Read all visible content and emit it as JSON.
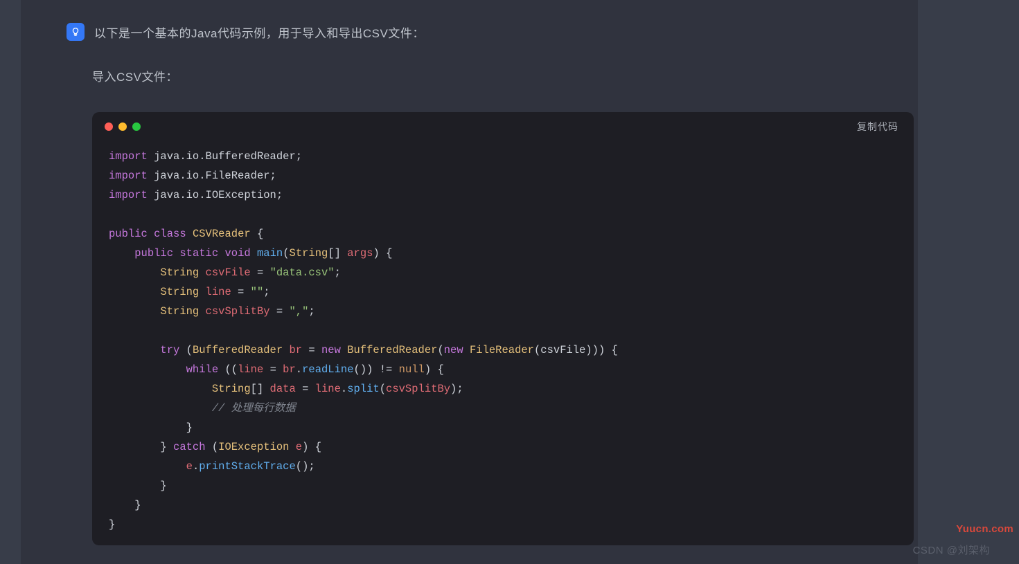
{
  "intro": "以下是一个基本的Java代码示例，用于导入和导出CSV文件：",
  "section_label": "导入CSV文件：",
  "copy_label": "复制代码",
  "watermark_csdn": "CSDN @刘架构",
  "watermark_site": "Yuucn.com",
  "code": {
    "l01": {
      "kw": "import",
      "rest": " java.io.BufferedReader;"
    },
    "l02": {
      "kw": "import",
      "rest": " java.io.FileReader;"
    },
    "l03": {
      "kw": "import",
      "rest": " java.io.IOException;"
    },
    "l05": {
      "kw1": "public",
      "kw2": "class",
      "cls": "CSVReader",
      "brace": " {"
    },
    "l06": {
      "kw1": "public",
      "kw2": "static",
      "kw3": "void",
      "fn": "main",
      "open": "(",
      "type": "String",
      "arr": "[] ",
      "arg": "args",
      "close": ") {"
    },
    "l07": {
      "type": "String",
      "var": " csvFile",
      "eq": " = ",
      "str": "\"data.csv\"",
      "semi": ";"
    },
    "l08": {
      "type": "String",
      "var": " line",
      "eq": " = ",
      "str": "\"\"",
      "semi": ";"
    },
    "l09": {
      "type": "String",
      "var": " csvSplitBy",
      "eq": " = ",
      "str": "\",\"",
      "semi": ";"
    },
    "l11": {
      "kw": "try",
      "open": " (",
      "type1": "BufferedReader",
      "var": " br",
      "eq": " = ",
      "kw2": "new",
      "sp": " ",
      "type2": "BufferedReader",
      "p1": "(",
      "kw3": "new",
      "sp2": " ",
      "type3": "FileReader",
      "p2": "(csvFile))) {"
    },
    "l12": {
      "kw": "while",
      "open": " ((",
      "var": "line",
      "eq": " = ",
      "obj": "br",
      "dot": ".",
      "fn": "readLine",
      "call": "()) != ",
      "null": "null",
      "close": ") {"
    },
    "l13": {
      "type": "String",
      "arr": "[] ",
      "var": "data",
      "eq": " = ",
      "obj": "line",
      "dot": ".",
      "fn": "split",
      "open": "(",
      "arg": "csvSplitBy",
      "close": ");"
    },
    "l14": {
      "cmt": "// 处理每行数据"
    },
    "l15": {
      "brace": "}"
    },
    "l16": {
      "brace": "} ",
      "kw": "catch",
      "open": " (",
      "type": "IOException",
      "var": " e",
      "close": ") {"
    },
    "l17": {
      "obj": "e",
      "dot": ".",
      "fn": "printStackTrace",
      "call": "();"
    },
    "l18": {
      "brace": "}"
    },
    "l19": {
      "brace": "}"
    },
    "l20": {
      "brace": "}"
    }
  }
}
